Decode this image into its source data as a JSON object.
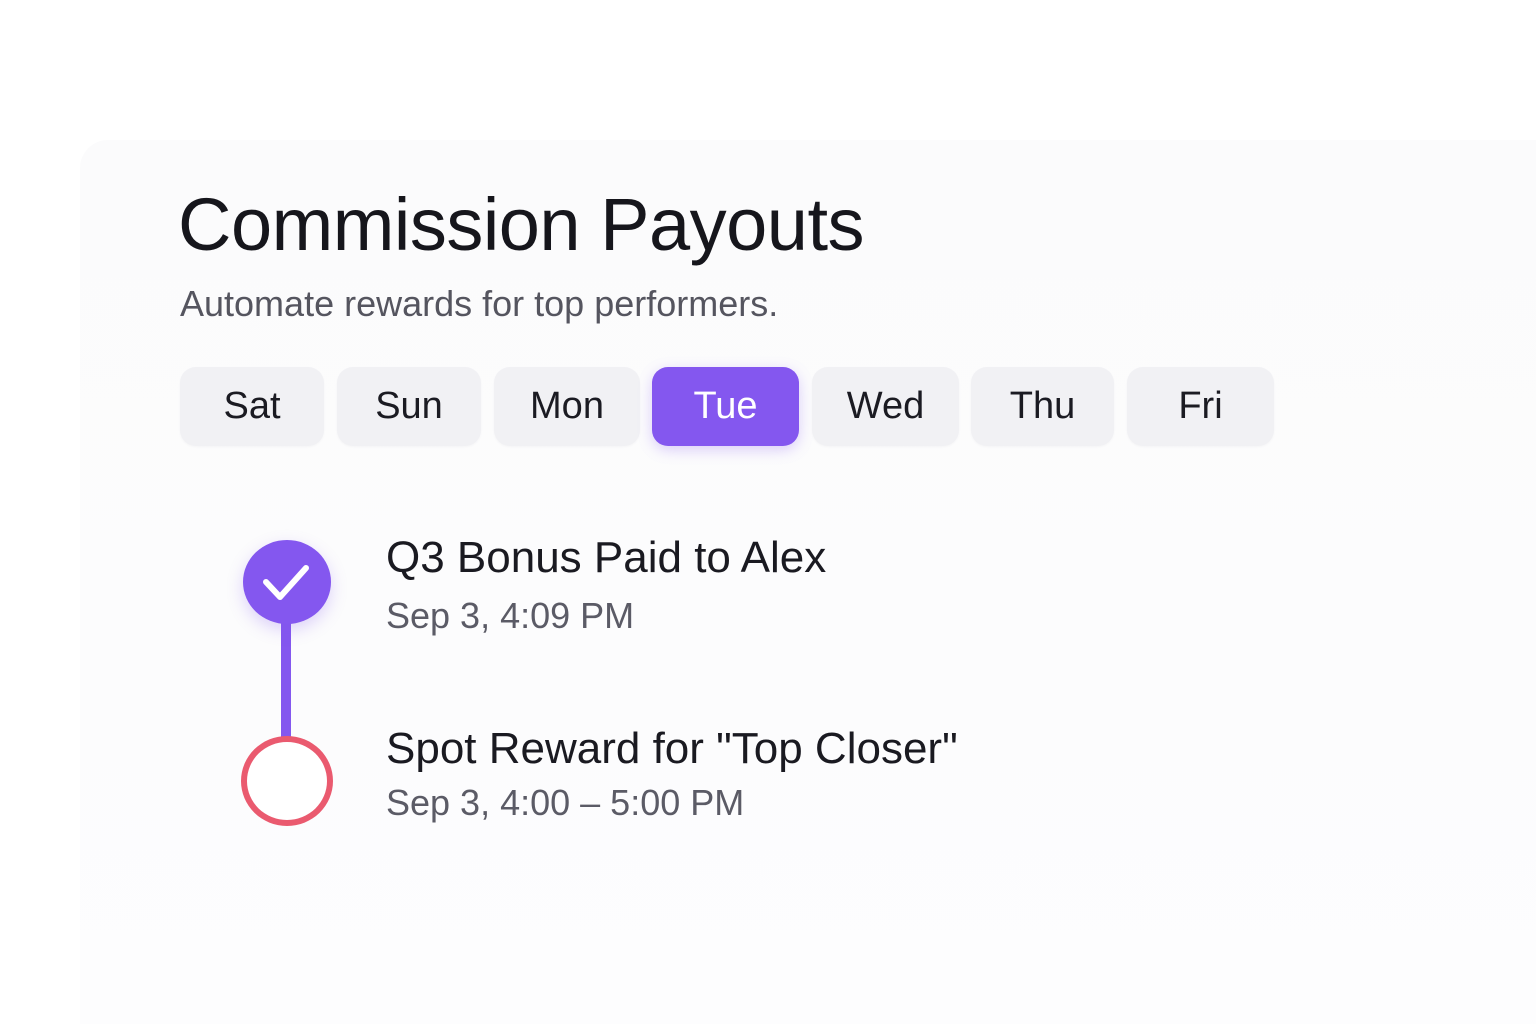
{
  "header": {
    "title": "Commission Payouts",
    "subtitle": "Automate rewards for top performers."
  },
  "day_tabs": {
    "items": [
      {
        "label": "Sat",
        "active": false
      },
      {
        "label": "Sun",
        "active": false
      },
      {
        "label": "Mon",
        "active": false
      },
      {
        "label": "Tue",
        "active": true
      },
      {
        "label": "Wed",
        "active": false
      },
      {
        "label": "Thu",
        "active": false
      },
      {
        "label": "Fri",
        "active": false
      }
    ]
  },
  "timeline": {
    "events": [
      {
        "title": "Q3 Bonus Paid to Alex",
        "time": "Sep 3, 4:09 PM",
        "status": "completed",
        "icon": "check-icon"
      },
      {
        "title": "Spot Reward for \"Top Closer\"",
        "time": "Sep 3, 4:00 – 5:00 PM",
        "status": "pending",
        "icon": "empty-circle-icon"
      }
    ]
  },
  "colors": {
    "accent": "#8457ef",
    "pending": "#ea5a6f",
    "tab_bg": "#f1f1f4",
    "text": "#16161c",
    "muted": "#55555f"
  }
}
